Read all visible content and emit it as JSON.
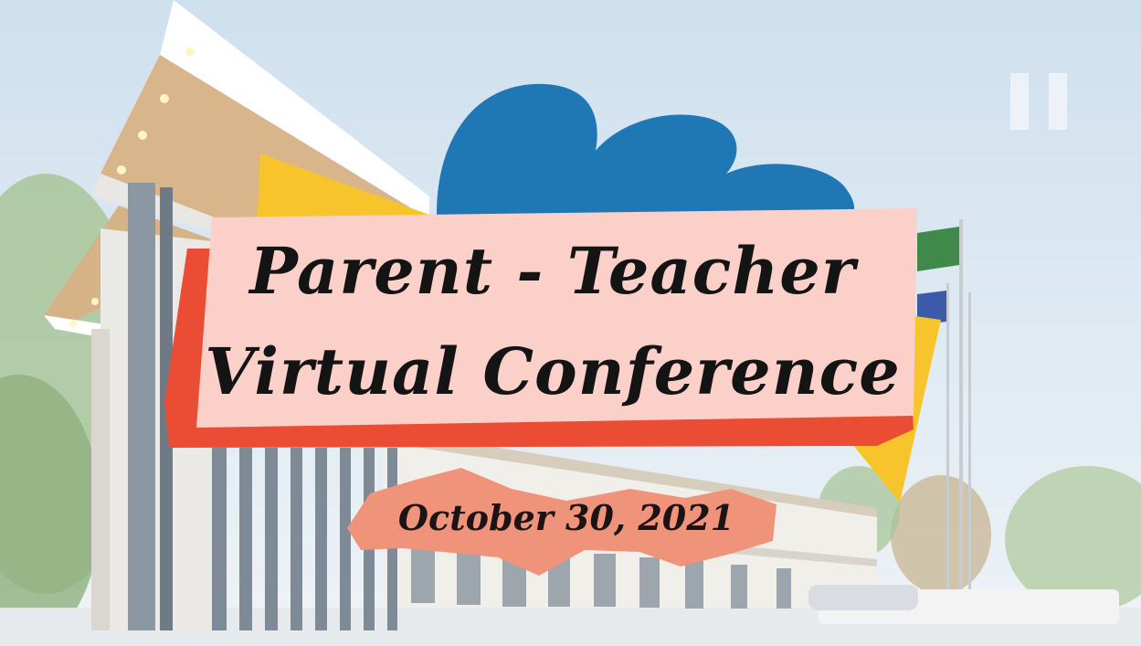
{
  "title": {
    "line1": "Parent - Teacher",
    "line2": "Virtual Conference"
  },
  "date": "October 30, 2021",
  "icons": {
    "pause": "pause-icon"
  },
  "colors": {
    "blue_blob": "#1f77b4",
    "yellow_shape": "#f7c52b",
    "red_brush": "#ea4d33",
    "pink_banner": "#fbd0c9",
    "date_brush": "#f0937b",
    "sky": "#dfe9f2"
  }
}
